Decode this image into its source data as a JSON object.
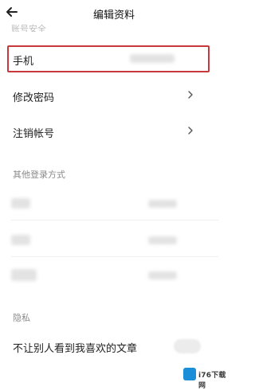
{
  "header": {
    "title": "编辑资料",
    "back_icon": "arrow-left-icon"
  },
  "account": {
    "section_label_faded": "账号安全",
    "phone_label": "手机",
    "phone_value": "",
    "change_password_label": "修改密码",
    "deregister_label": "注销帐号"
  },
  "other_login": {
    "section_label": "其他登录方式"
  },
  "privacy": {
    "section_label": "隐私",
    "hide_likes_label": "不让别人看到我喜欢的文章"
  },
  "watermark": {
    "text": "i76下载网"
  },
  "colors": {
    "highlight_border": "#c8393e",
    "watermark_logo": "#1a8fd8"
  }
}
